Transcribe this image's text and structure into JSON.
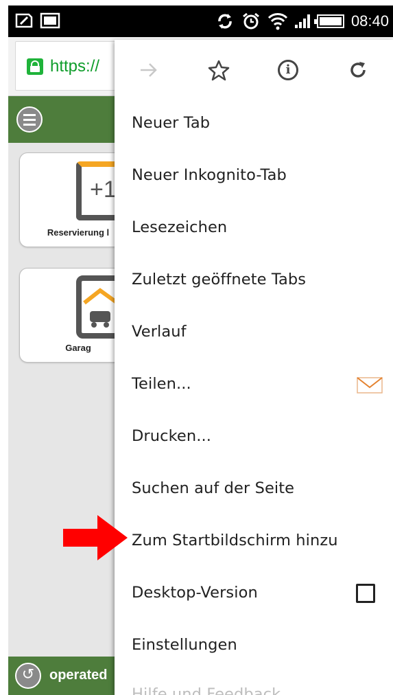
{
  "status_bar": {
    "time": "08:40",
    "icons": [
      "sim-icon",
      "screen-icon",
      "sync-icon",
      "alarm-icon",
      "wifi-icon",
      "signal-icon",
      "battery-icon"
    ]
  },
  "url_bar": {
    "url_text": "https://"
  },
  "app": {
    "tiles": [
      {
        "label": "Reservierung l",
        "icon": "plus-one-icon",
        "icon_text": "+1"
      },
      {
        "label": "Garag",
        "icon": "garage-icon"
      }
    ],
    "footer_text": "operated"
  },
  "menu": {
    "toolbar": [
      "forward-icon",
      "star-icon",
      "info-icon",
      "reload-icon"
    ],
    "items": [
      {
        "label": "Neuer Tab"
      },
      {
        "label": "Neuer Inkognito-Tab"
      },
      {
        "label": "Lesezeichen"
      },
      {
        "label": "Zuletzt geöffnete Tabs"
      },
      {
        "label": "Verlauf"
      },
      {
        "label": "Teilen...",
        "trailing_icon": "mail-icon"
      },
      {
        "label": "Drucken..."
      },
      {
        "label": "Suchen auf der Seite"
      },
      {
        "label": "Zum Startbildschirm hinzu"
      },
      {
        "label": "Desktop-Version",
        "checked": false
      },
      {
        "label": "Einstellungen"
      },
      {
        "label": "Hilfe und Feedback"
      }
    ]
  },
  "colors": {
    "accent_green": "#4e7d3c",
    "lock_green": "#1fb33a",
    "annotation_red": "#ff0000"
  }
}
